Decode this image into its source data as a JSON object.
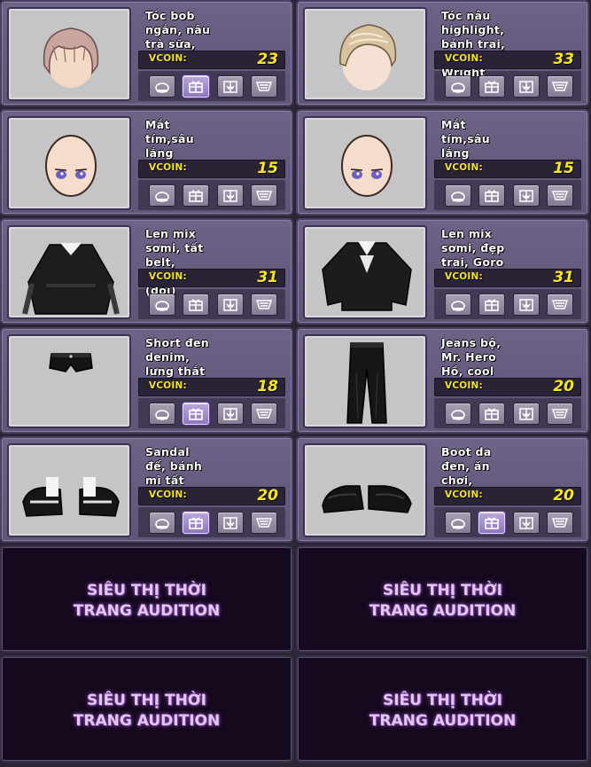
{
  "items": [
    {
      "name": "Tóc bob ngắn, nâu trà sữa, Kattaway",
      "vcoin_label": "VCOIN:",
      "price": "23",
      "thumb_icon": "hair-bob-icon",
      "buy_active": true
    },
    {
      "name": "Tóc nâu highlight, bảnh trai, Edgar Wright",
      "vcoin_label": "VCOIN:",
      "price": "33",
      "thumb_icon": "hair-highlight-icon",
      "buy_active": false
    },
    {
      "name": "Mắt tím,sâu lắng",
      "vcoin_label": "VCOIN:",
      "price": "15",
      "thumb_icon": "eyes-face-icon",
      "buy_active": false
    },
    {
      "name": "Mắt tím,sâu lắng",
      "vcoin_label": "VCOIN:",
      "price": "15",
      "thumb_icon": "eyes-face-icon",
      "buy_active": false
    },
    {
      "name": "Len mix sơmi, tất belt, Gwatan (đôi)",
      "vcoin_label": "VCOIN:",
      "price": "31",
      "thumb_icon": "sweater-dress-icon",
      "buy_active": false
    },
    {
      "name": "Len mix sơmi, đẹp trai, Goro (đôi)",
      "vcoin_label": "VCOIN:",
      "price": "31",
      "thumb_icon": "sweater-shirt-icon",
      "buy_active": false
    },
    {
      "name": "Short đen denim, lưng thắt dây",
      "vcoin_label": "VCOIN:",
      "price": "18",
      "thumb_icon": "shorts-icon",
      "buy_active": true
    },
    {
      "name": "Jeans bộ, Mr. Hero Hồ, cool ngầu",
      "vcoin_label": "VCOIN:",
      "price": "20",
      "thumb_icon": "jeans-icon",
      "buy_active": false
    },
    {
      "name": "Sandal đế, bánh mì tất trắng Yuju",
      "vcoin_label": "VCOIN:",
      "price": "20",
      "thumb_icon": "sandal-icon",
      "buy_active": true
    },
    {
      "name": "Boot da đen, ăn chơi, Woodbury",
      "vcoin_label": "VCOIN:",
      "price": "20",
      "thumb_icon": "boots-icon",
      "buy_active": true
    }
  ],
  "promos": [
    {
      "line1": "SIÊU THỊ THỜI",
      "line2": "TRANG AUDITION"
    },
    {
      "line1": "SIÊU THỊ THỜI",
      "line2": "TRANG AUDITION"
    },
    {
      "line1": "SIÊU THỊ THỜI",
      "line2": "TRANG AUDITION"
    },
    {
      "line1": "SIÊU THỊ THỜI",
      "line2": "TRANG AUDITION"
    }
  ],
  "button_icons": [
    "try-on-icon",
    "gift-icon",
    "wardrobe-icon",
    "cart-icon"
  ],
  "colors": {
    "price": "#f6e81c",
    "card": "#6e6286",
    "promo_bg": "#14091d",
    "promo_text": "#e2c8f0"
  }
}
